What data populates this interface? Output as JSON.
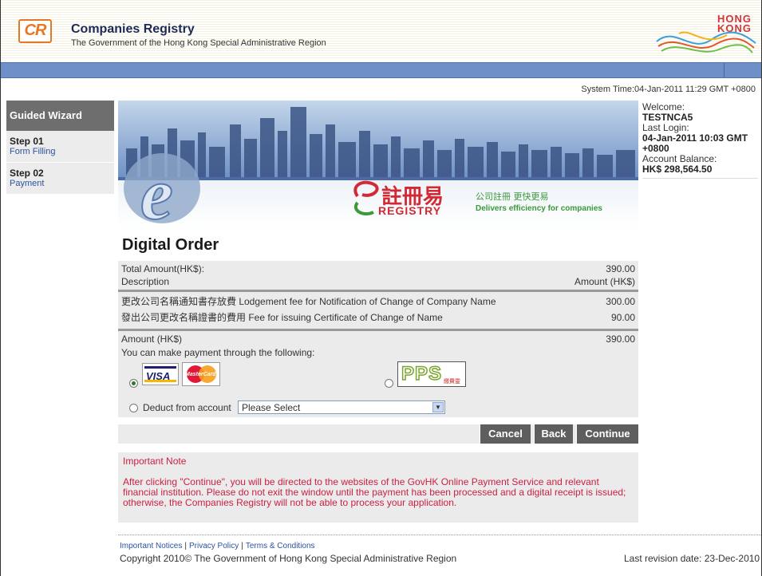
{
  "header": {
    "logo_text": "CR",
    "title": "Companies Registry",
    "subtitle": "The Government of the Hong Kong Special Administrative Region",
    "brand_logo": "HONG KONG"
  },
  "system_time": "System Time:04-Jan-2011 11:29 GMT +0800",
  "wizard": {
    "heading": "Guided Wizard",
    "steps": [
      {
        "num": "Step 01",
        "label": "Form Filling"
      },
      {
        "num": "Step 02",
        "label": "Payment"
      }
    ]
  },
  "banner": {
    "chinese_title": "註冊易",
    "english_title": "REGISTRY",
    "tagline_cn": "公司註冊 更快更易",
    "tagline_en": "Delivers efficiency for companies"
  },
  "user": {
    "welcome_label": "Welcome:",
    "username": "TESTNCA5",
    "last_login_label": "Last Login:",
    "last_login": "04-Jan-2011 10:03 GMT +0800",
    "balance_label": "Account Balance:",
    "balance": "HK$ 298,564.50"
  },
  "order": {
    "title": "Digital Order",
    "total_label": "Total Amount(HK$):",
    "total_value": "390.00",
    "desc_header": "Description",
    "amount_header": "Amount (HK$)",
    "items": [
      {
        "desc": "更改公司名稱通知書存放費 Lodgement fee for Notification of Change of Company Name",
        "amount": "300.00"
      },
      {
        "desc": "發出公司更改名稱證書的費用 Fee for issuing Certificate of Change of Name",
        "amount": "90.00"
      }
    ],
    "amount_label": "Amount (HK$)",
    "amount_value": "390.00"
  },
  "payment": {
    "intro": "You can make payment through the following:",
    "visa_label": "VISA",
    "mastercard_label": "MasterCard",
    "pps_label": "PPS",
    "pps_sub": "繳費靈",
    "deduct_label": "Deduct from account",
    "select_value": "Please Select"
  },
  "buttons": {
    "cancel": "Cancel",
    "back": "Back",
    "continue": "Continue"
  },
  "note": {
    "heading": "Important Note",
    "body": "After clicking \"Continue\", you will be directed to the websites of the GovHK Online Payment Service and relevant financial institution. Please do not exit the window until the payment has been processed and a digital receipt is issued; otherwise, the Companies Registry will not be able to process your application."
  },
  "footer": {
    "links": [
      "Important Notices",
      "Privacy Policy",
      "Terms & Conditions"
    ],
    "copyright": "Copyright 2010© The Government of Hong Kong Special Administrative Region",
    "revision": "Last revision date: 23-Dec-2010"
  },
  "colors": {
    "accent_orange": "#e87722",
    "header_bar_blue": "#6f8fc9",
    "button_gray": "#5e5e5e",
    "note_red": "#cc1f42",
    "link_blue": "#2a54a1"
  }
}
